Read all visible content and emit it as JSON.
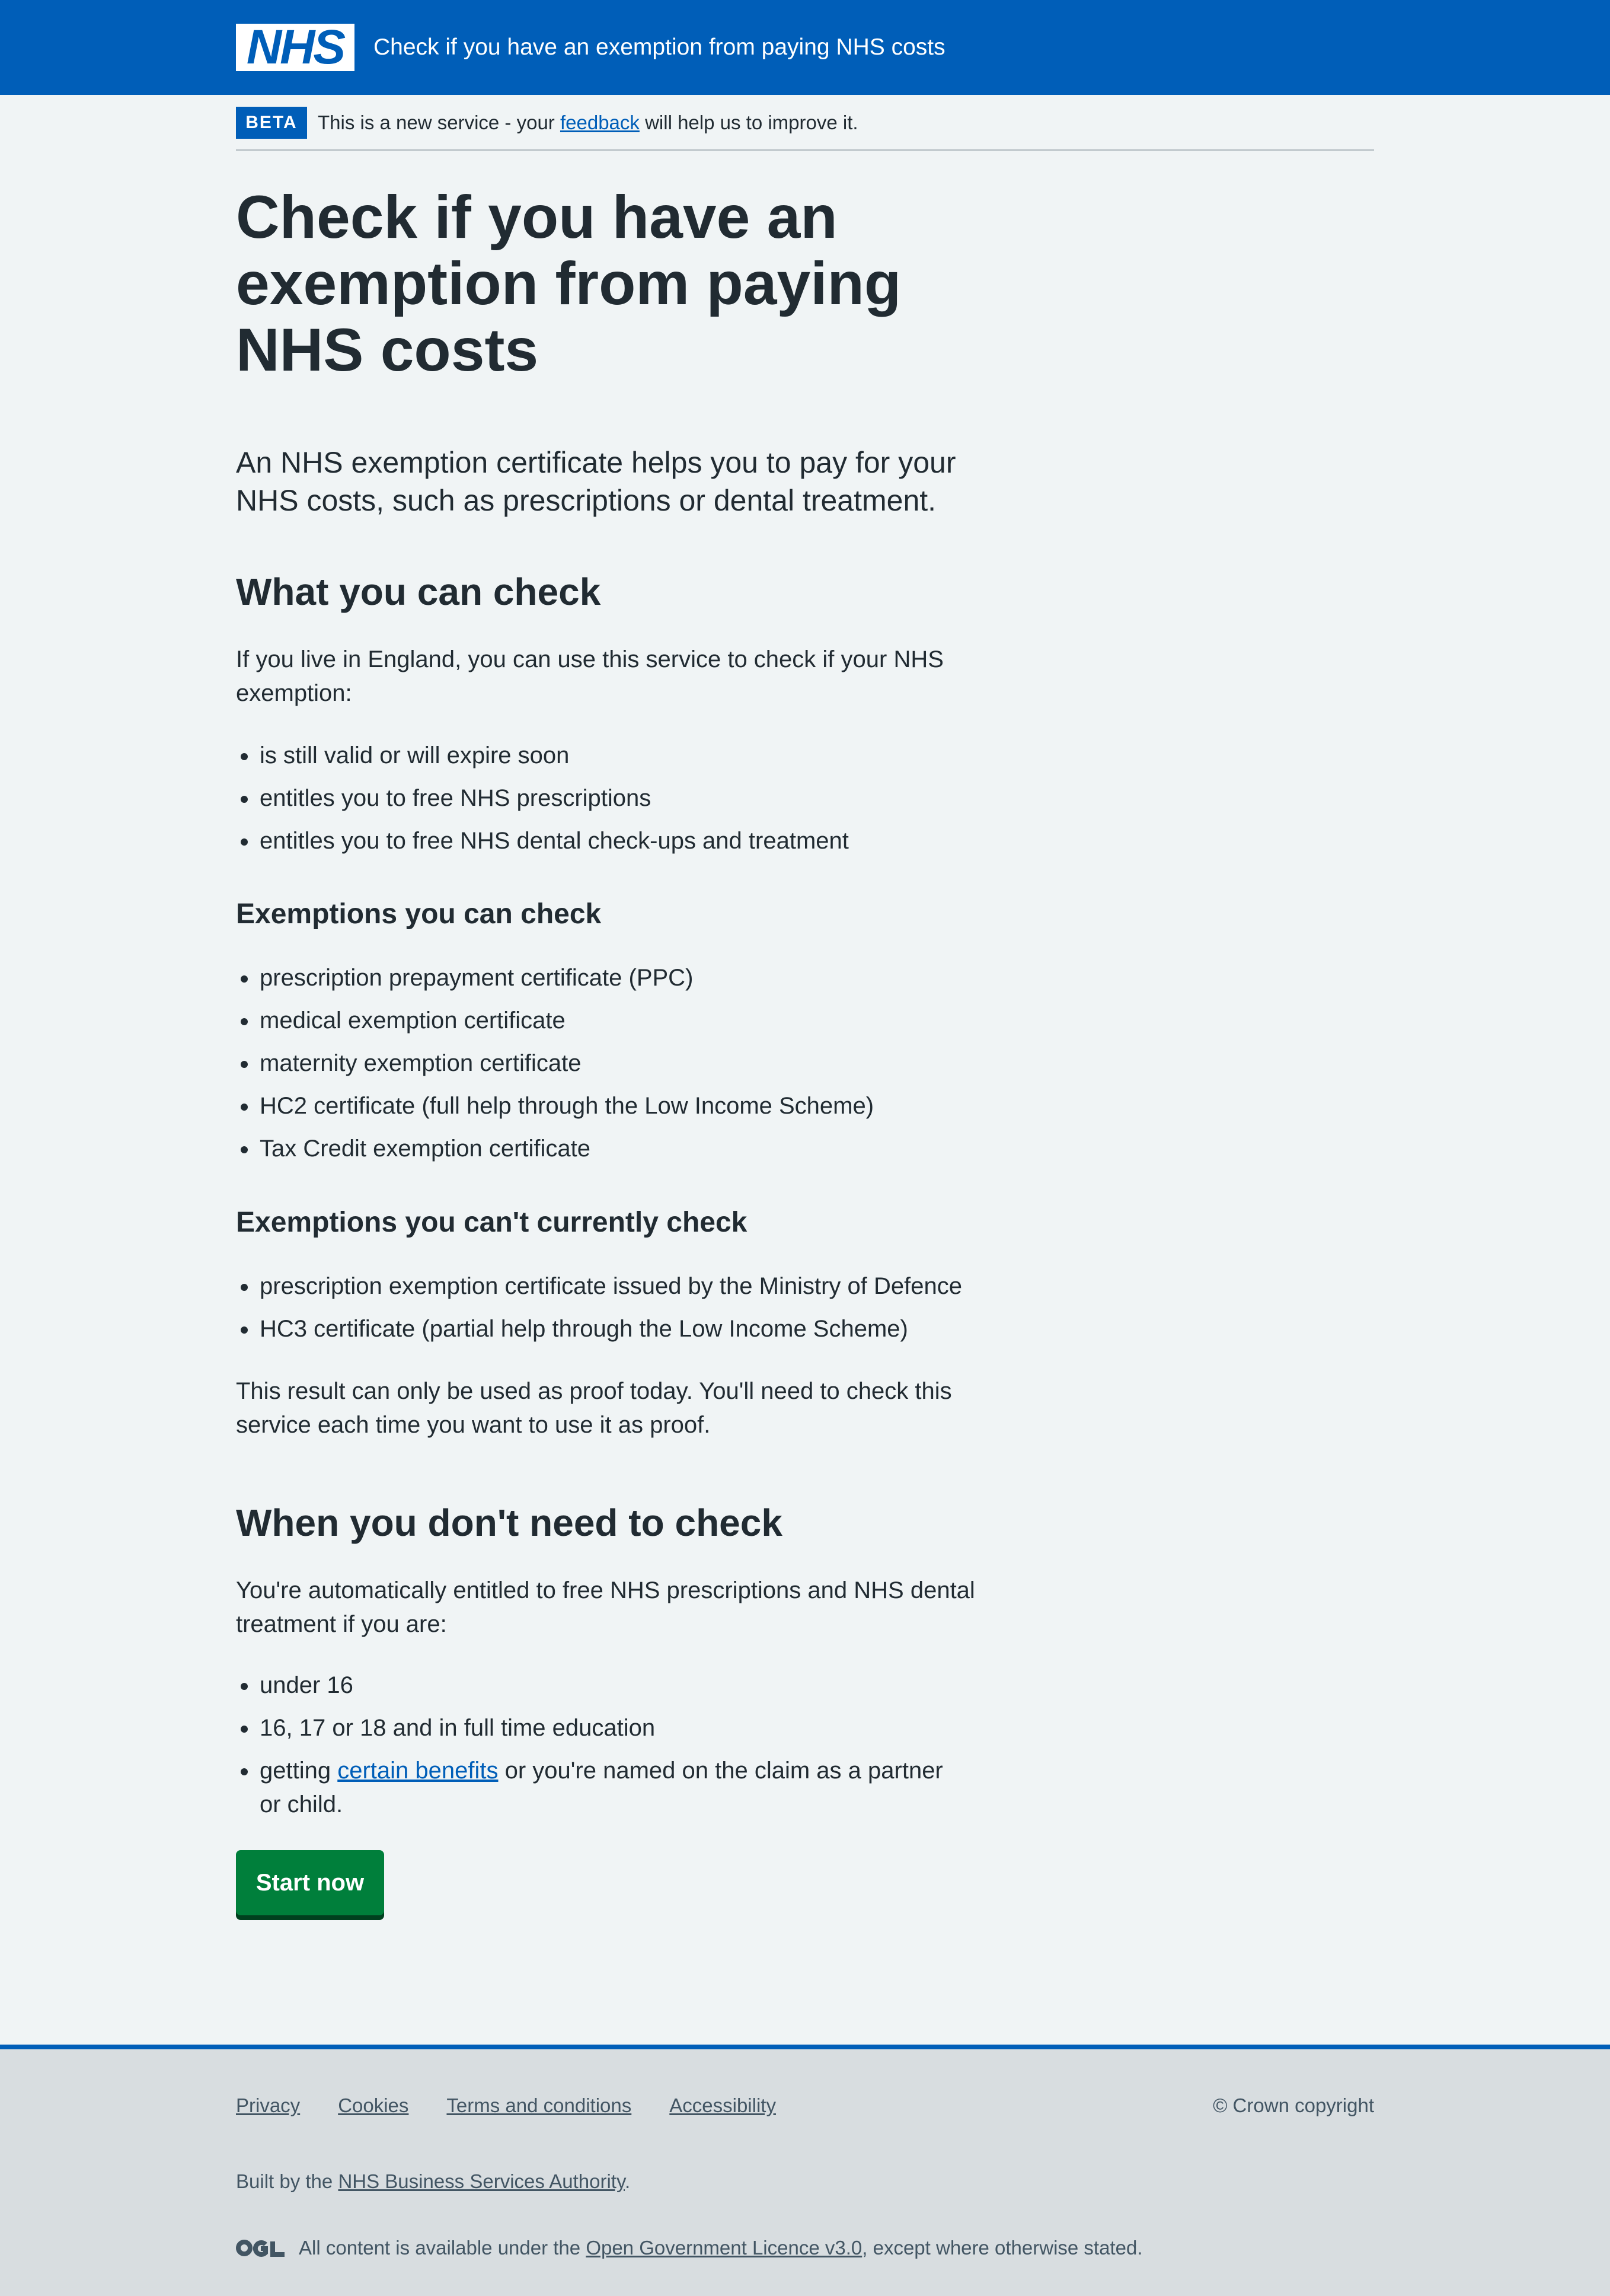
{
  "header": {
    "logo_text": "NHS",
    "service_name": "Check if you have an exemption from paying NHS costs"
  },
  "phase_banner": {
    "tag": "BETA",
    "text_before": "This is a new service - your ",
    "link": "feedback",
    "text_after": " will help us to improve it."
  },
  "main": {
    "title_lines": [
      "Check if you have an",
      "exemption from paying",
      "NHS costs"
    ],
    "lead_lines": [
      "An NHS exemption certificate helps you to pay for your",
      "NHS costs, such as prescriptions or dental treatment."
    ],
    "section_what": {
      "heading": "What you can check",
      "intro_lines": [
        "If you live in England, you can use this service to check if your NHS",
        "exemption:"
      ],
      "items": [
        "is still valid or will expire soon",
        "entitles you to free NHS prescriptions",
        "entitles you to free NHS dental check-ups and treatment"
      ]
    },
    "section_can": {
      "heading": "Exemptions you can check",
      "items": [
        "prescription prepayment certificate (PPC)",
        "medical exemption certificate",
        "maternity exemption certificate",
        "HC2 certificate (full help through the Low Income Scheme)",
        "Tax Credit exemption certificate"
      ]
    },
    "section_cant": {
      "heading": "Exemptions you can't currently check",
      "items": [
        "prescription exemption certificate issued by the Ministry of Defence",
        "HC3 certificate (partial help through the Low Income Scheme)"
      ],
      "note_lines": [
        "This result can only be used as proof today. You'll need to check this",
        "service each time you want to use it as proof."
      ]
    },
    "section_dont": {
      "heading": "When you don't need to check",
      "intro_lines": [
        "You're automatically entitled to free NHS prescriptions and NHS dental",
        "treatment if you are:"
      ],
      "items": [
        "under 16",
        "16, 17 or 18 and in full time education"
      ],
      "benefits_item": {
        "before": "getting ",
        "link": "certain benefits",
        "after_line1": " or you're named on the claim as a partner",
        "after_line2": "or child."
      }
    },
    "start_button": "Start now"
  },
  "footer": {
    "links": [
      "Privacy",
      "Cookies",
      "Terms and conditions",
      "Accessibility"
    ],
    "copyright": "© Crown copyright",
    "built_by_before": "Built by the ",
    "built_by_link": "NHS Business Services Authority",
    "built_by_after": ".",
    "ogl_logo_text": "OGL",
    "licence_before": "All content is available under the ",
    "licence_link": "Open Government Licence v3.0",
    "licence_after": ", except where otherwise stated."
  },
  "colors": {
    "nhs_blue": "#005eb8",
    "background": "#f0f4f5",
    "text": "#212b32",
    "button_green": "#007f3b",
    "footer_bg": "#d8dde0",
    "footer_text": "#425563"
  }
}
